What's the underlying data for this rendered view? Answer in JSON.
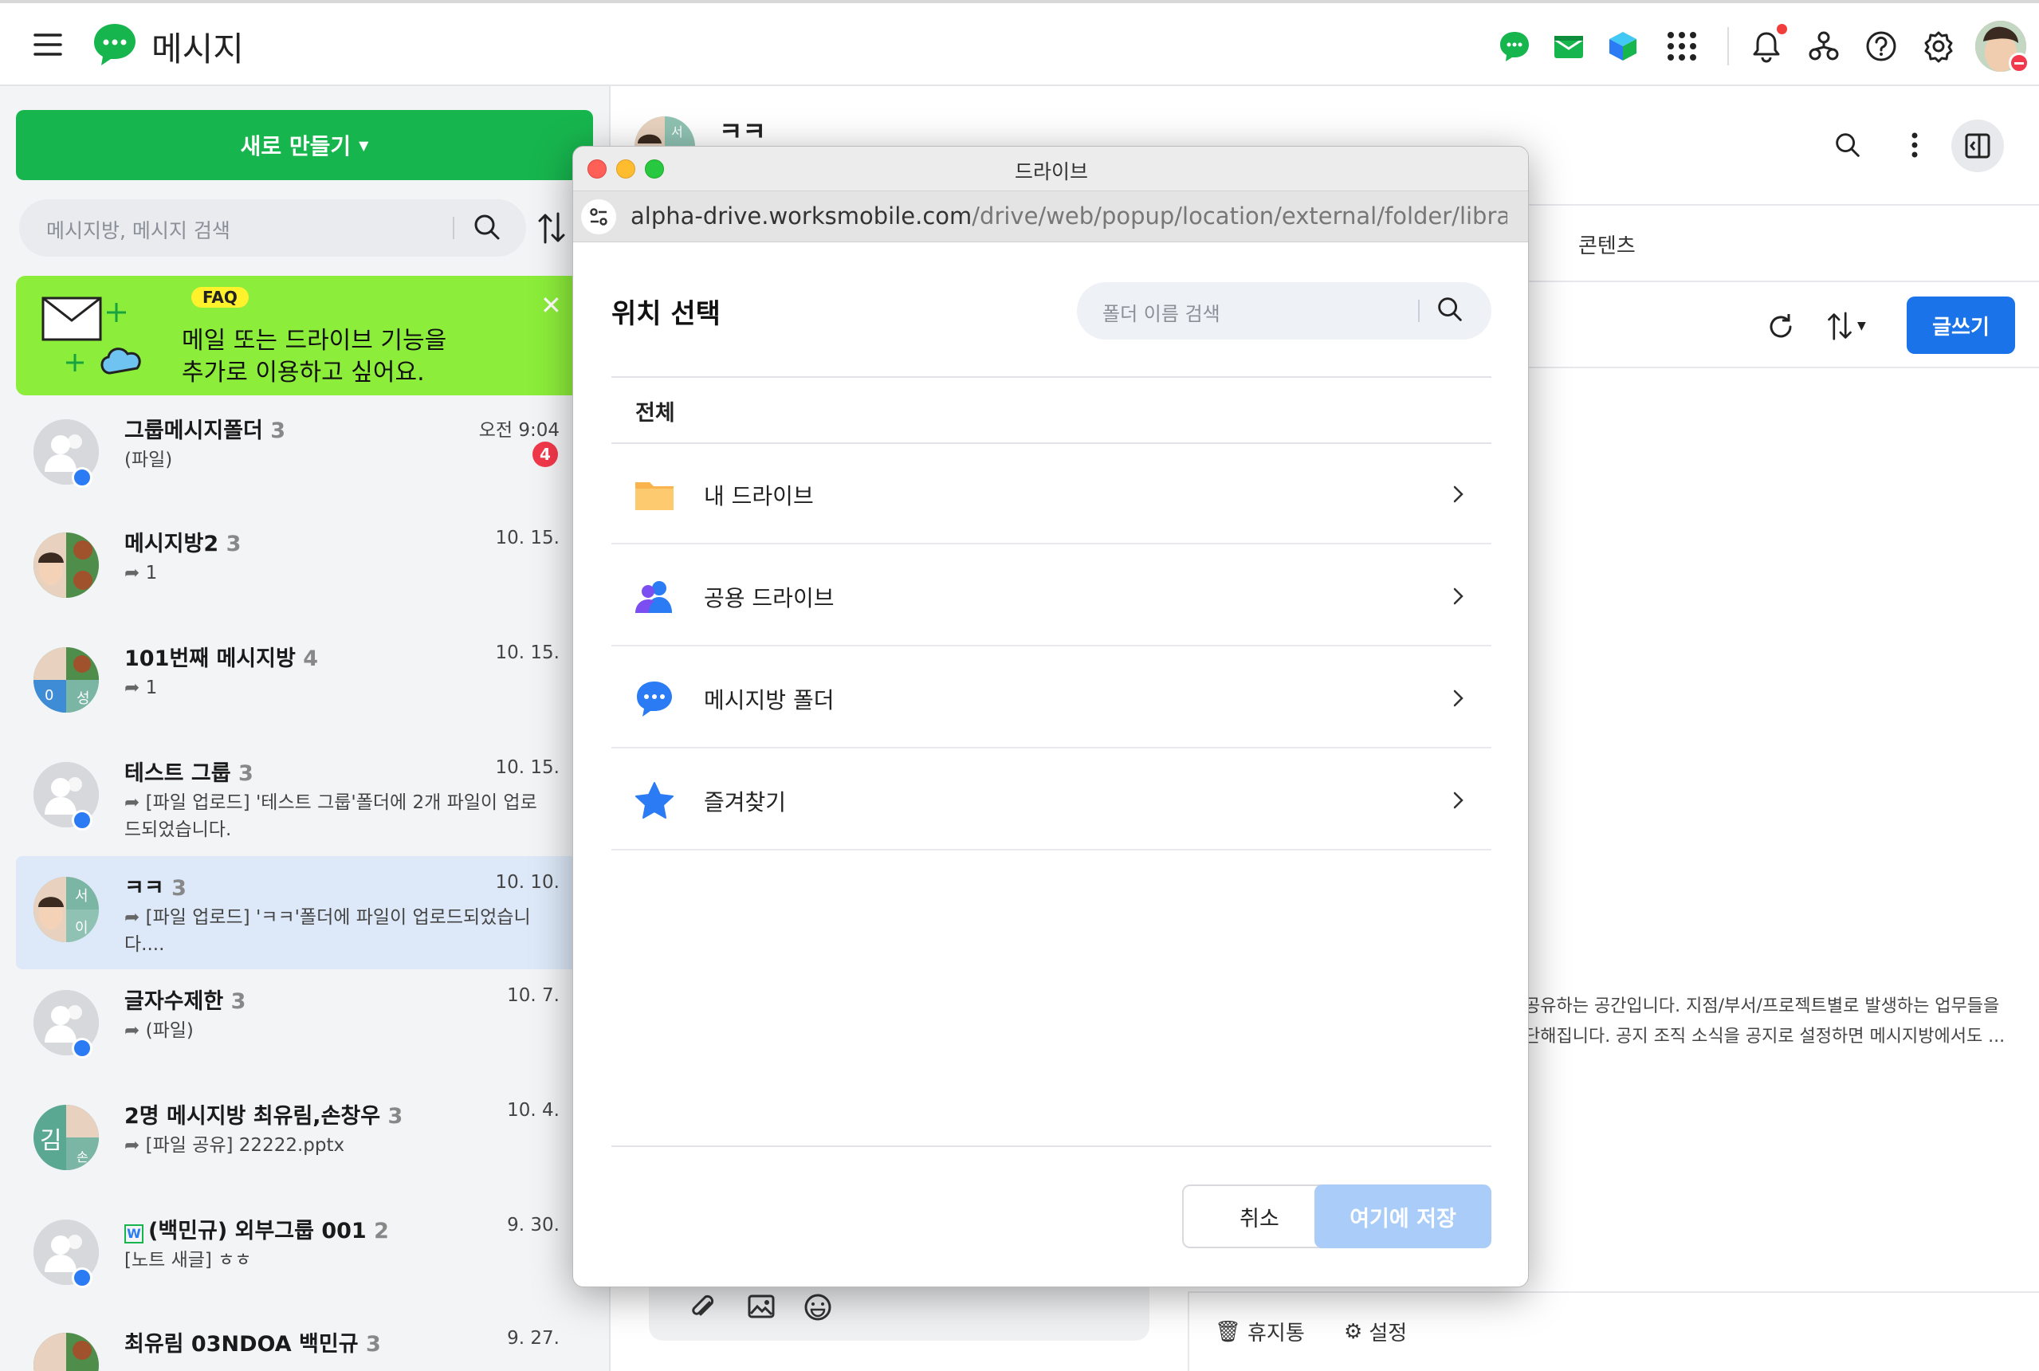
{
  "app": {
    "title": "메시지"
  },
  "sidebar": {
    "new_button": "새로 만들기",
    "search_placeholder": "메시지방, 메시지 검색",
    "banner": {
      "faq": "FAQ",
      "line1": "메일 또는 드라이브 기능을",
      "line2": "추가로 이용하고 싶어요."
    },
    "rooms": [
      {
        "name": "그룹메시지폴더",
        "count": "3",
        "time": "오전 9:04",
        "preview": "(파일)",
        "unread": "4"
      },
      {
        "name": "메시지방2",
        "count": "3",
        "time": "10. 15.",
        "preview": "1"
      },
      {
        "name": "101번째 메시지방",
        "count": "4",
        "time": "10. 15.",
        "preview": "1",
        "avatar_labels": [
          "0",
          "성"
        ]
      },
      {
        "name": "테스트 그룹",
        "count": "3",
        "time": "10. 15.",
        "preview": "[파일 업로드] '테스트 그룹'폴더에 2개 파일이 업로드되었습니다."
      },
      {
        "name": "ㅋㅋ",
        "count": "3",
        "time": "10. 10.",
        "preview": "[파일 업로드] 'ㅋㅋ'폴더에 파일이 업로드되었습니다....",
        "avatar_labels": [
          "서",
          "이"
        ]
      },
      {
        "name": "글자수제한",
        "count": "3",
        "time": "10. 7.",
        "preview": "(파일)"
      },
      {
        "name": "2명 메시지방 최유림,손창우",
        "count": "3",
        "time": "10. 4.",
        "preview": "[파일 공유] 22222.pptx",
        "avatar_labels": [
          "김",
          "손"
        ]
      },
      {
        "name": "(백민규) 외부그룹 001",
        "count": "2",
        "time": "9. 30.",
        "preview": "[노트 새글] ㅎㅎ"
      },
      {
        "name": "최유림 03NDOA 백민규",
        "count": "3",
        "time": "9. 27."
      }
    ]
  },
  "chat": {
    "title": "ㅋㅋ",
    "avatar_label": "서",
    "tab_contents": "콘텐츠",
    "write_button": "글쓰기",
    "desc_line1": "공유하는 공간입니다. 지점/부서/프로젝트별로 발생하는 업무들을",
    "desc_line2": "단해집니다. 공지 조직 소식을 공지로 설정하면 메시지방에서도 ...",
    "trash": "휴지통",
    "settings": "설정"
  },
  "modal": {
    "window_title": "드라이브",
    "url_host": "alpha-drive.worksmobile.com",
    "url_path": "/drive/web/popup/location/external/folder/library?ti...",
    "heading": "위치 선택",
    "search_placeholder": "폴더 이름 검색",
    "all_label": "전체",
    "folders": [
      {
        "label": "내 드라이브",
        "icon": "folder-icon"
      },
      {
        "label": "공용 드라이브",
        "icon": "shared-users-icon"
      },
      {
        "label": "메시지방 폴더",
        "icon": "message-bubble-icon"
      },
      {
        "label": "즐겨찾기",
        "icon": "star-icon"
      }
    ],
    "cancel": "취소",
    "save": "여기에 저장"
  },
  "colors": {
    "brand_green": "#17b54e",
    "primary_blue": "#1a73e8",
    "save_disabled": "#a9cdf8",
    "banner_green": "#8ced3a"
  }
}
